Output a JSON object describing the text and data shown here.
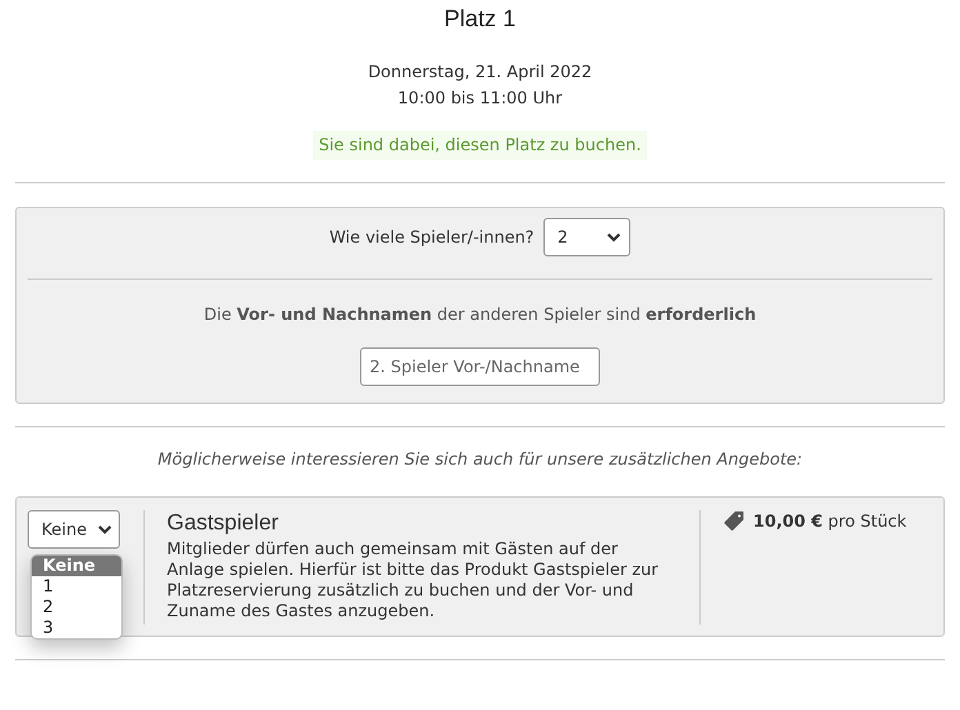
{
  "court": {
    "title": "Platz 1",
    "date": "Donnerstag, 21. April 2022",
    "time": "10:00 bis 11:00 Uhr",
    "notice": "Sie sind dabei, diesen Platz zu buchen."
  },
  "players": {
    "question": "Wie viele Spieler/-innen?",
    "count": "2",
    "requirement": "Die **Vor- und Nachnamen** der anderen Spieler sind **erforderlich**",
    "name_fields": [
      {
        "placeholder": "2. Spieler Vor-/Nachname"
      }
    ]
  },
  "offers_intro": "Möglicherweise interessieren Sie sich auch für unsere zusätzlichen Angebote:",
  "offers": [
    {
      "quantity": "Keine",
      "dropdown_open": true,
      "options": [
        {
          "label": "Keine",
          "selected": true
        },
        {
          "label": "1",
          "selected": false
        },
        {
          "label": "2",
          "selected": false
        },
        {
          "label": "3",
          "selected": false
        }
      ],
      "title": "Gastspieler",
      "description": "Mitglieder dürfen auch gemeinsam mit Gästen auf der Anlage spielen. Hierfür ist bitte das Produkt Gastspieler zur Platzreservierung zusätzlich zu buchen und der Vor- und Zuname des Gastes anzugeben.",
      "price": "**10,00 €** pro Stück"
    }
  ]
}
